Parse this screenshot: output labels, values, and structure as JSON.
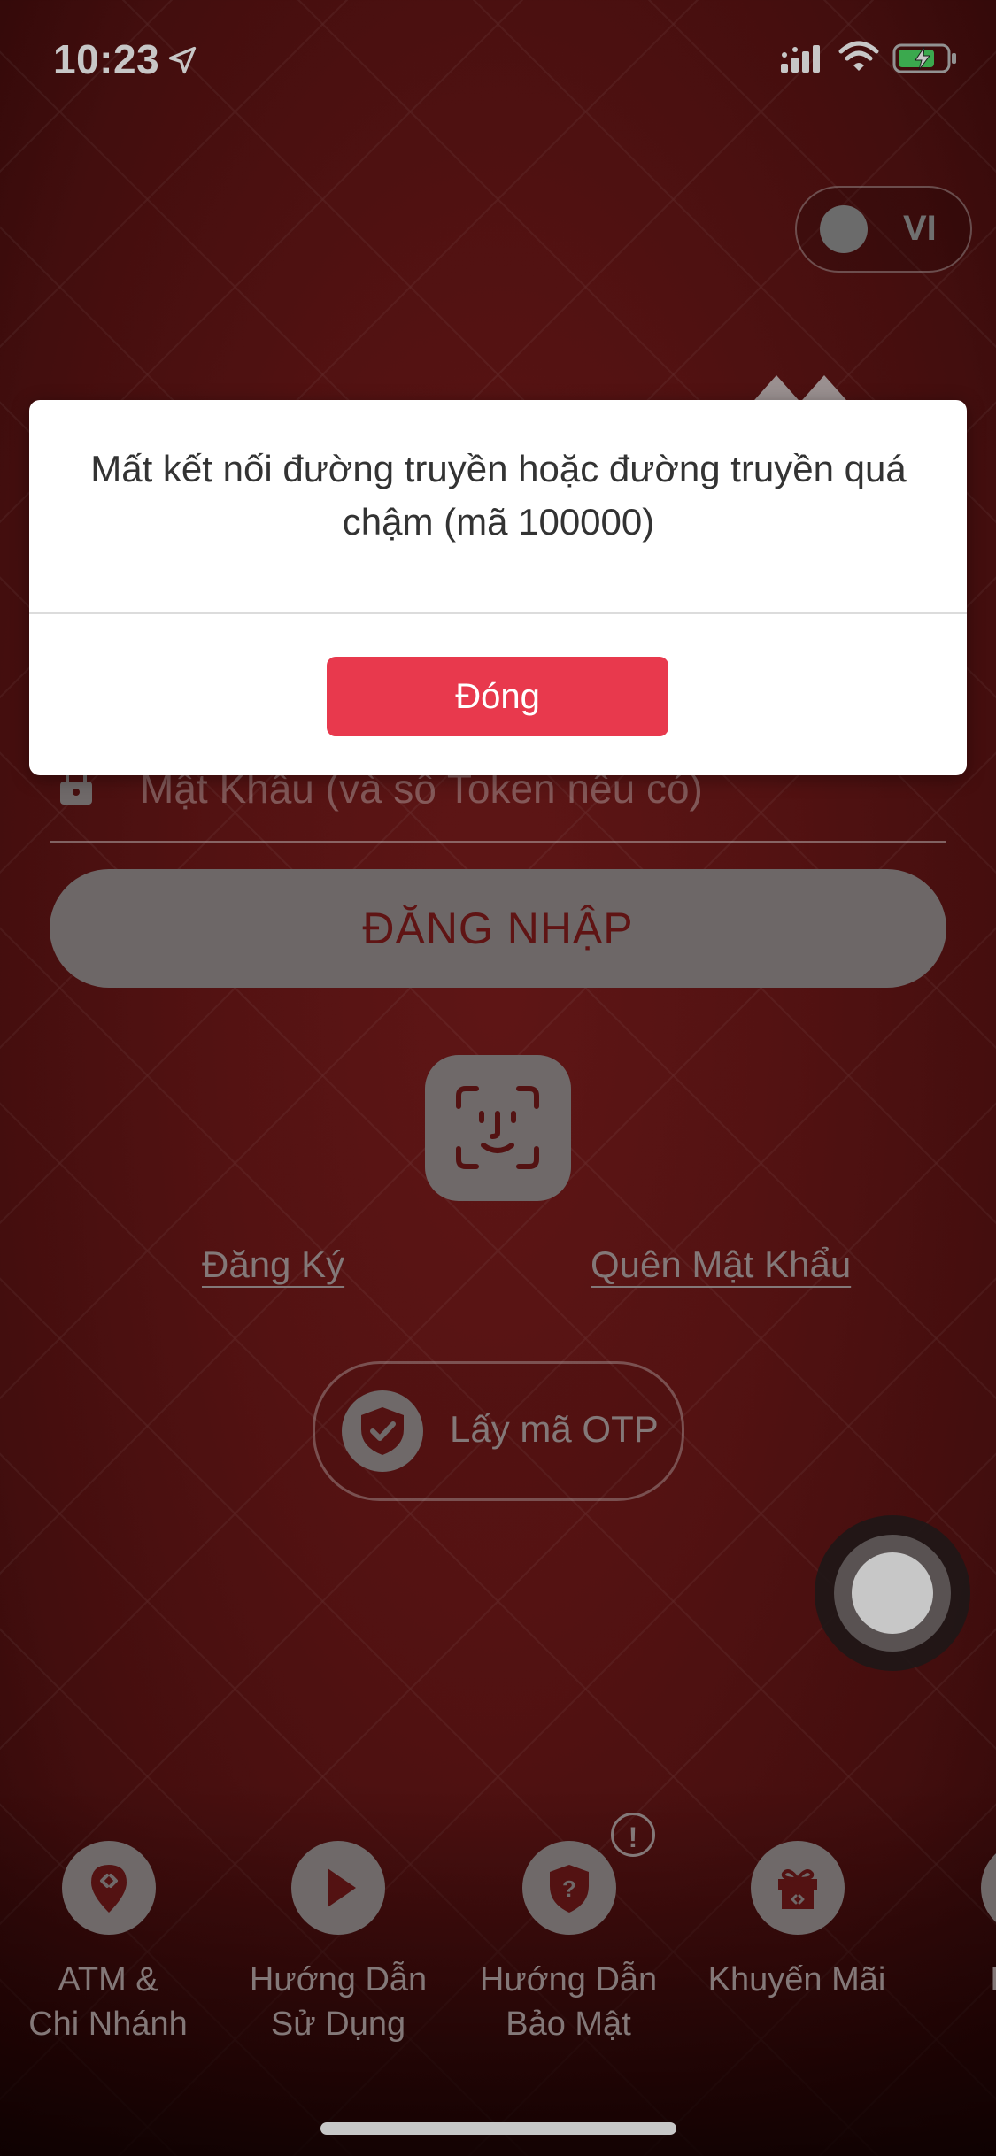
{
  "status_bar": {
    "time": "10:23",
    "icons": [
      "location-arrow-icon",
      "signal-icon",
      "wifi-icon",
      "battery-charging-icon"
    ]
  },
  "language_toggle": {
    "label": "VI"
  },
  "login": {
    "password_placeholder": "Mật Khẩu (và số Token nếu có)",
    "login_button": "ĐĂNG NHẬP",
    "register_link": "Đăng Ký",
    "forgot_password_link": "Quên Mật Khẩu",
    "otp_button": "Lấy mã OTP"
  },
  "bottom_nav": {
    "items": [
      {
        "line1": "ATM &",
        "line2": "Chi Nhánh",
        "icon": "location-pin-icon"
      },
      {
        "line1": "Hướng Dẫn",
        "line2": "Sử Dụng",
        "icon": "play-icon"
      },
      {
        "line1": "Hướng Dẫn",
        "line2": "Bảo Mật",
        "icon": "shield-question-icon",
        "badge": "!"
      },
      {
        "line1": "Khuyến Mãi",
        "line2": "",
        "icon": "gift-icon"
      },
      {
        "line1": "Li",
        "line2": "",
        "icon": "more-icon"
      }
    ]
  },
  "dialog": {
    "message": "Mất kết nối đường truyền hoặc đường truyền quá chậm (mã 100000)",
    "close_button": "Đóng"
  },
  "colors": {
    "background": "#6b1818",
    "dialog_button": "#e8394d",
    "muted_control": "#8f8787",
    "login_text": "#7a1a1a"
  }
}
